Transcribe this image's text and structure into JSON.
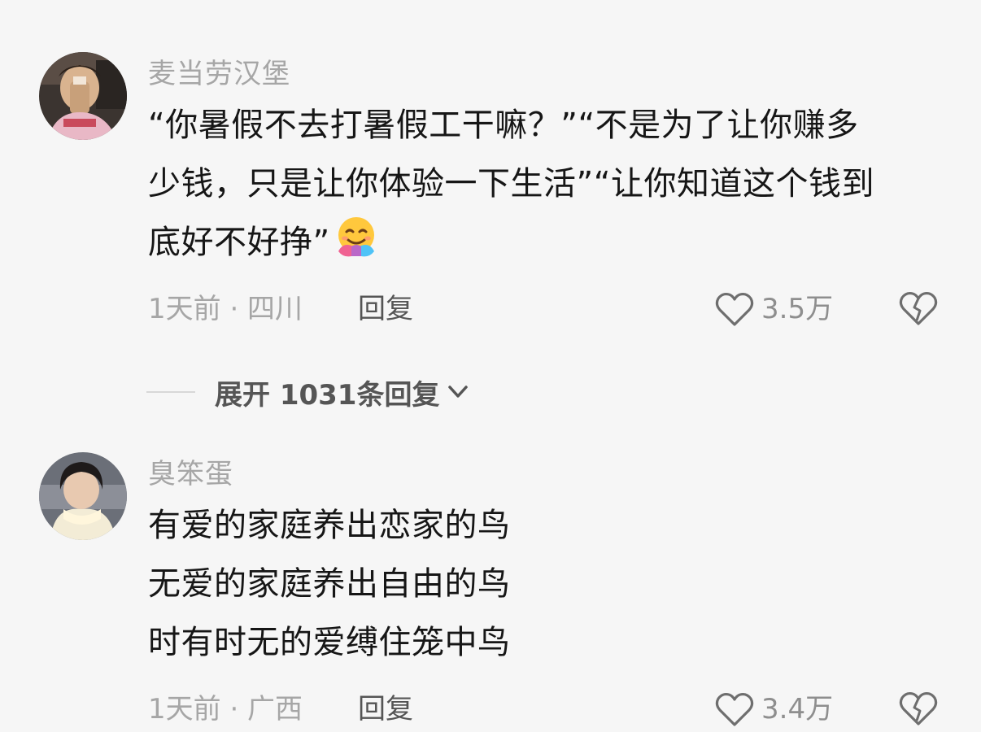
{
  "comments": [
    {
      "username": "麦当劳汉堡",
      "lines": [
        "“你暑假不去打暑假工干嘛？”“不是为了让你赚多",
        "少钱，只是让你体验一下生活”“让你知道这个钱到",
        "底好不好挣”"
      ],
      "emoji": "hugging-face-emoji",
      "time_location": "1天前 · 四川",
      "reply_label": "回复",
      "like_count": "3.5万"
    },
    {
      "username": "臭笨蛋",
      "lines": [
        "有爱的家庭养出恋家的鸟",
        "无爱的家庭养出自由的鸟",
        "时有时无的爱缚住笼中鸟"
      ],
      "time_location": "1天前 · 广西",
      "reply_label": "回复",
      "like_count": "3.4万"
    }
  ],
  "expand_replies": {
    "label": "展开 1031条回复"
  },
  "icons": {
    "like": "heart-outline-icon",
    "dislike": "broken-heart-icon",
    "expand": "chevron-down-icon"
  }
}
